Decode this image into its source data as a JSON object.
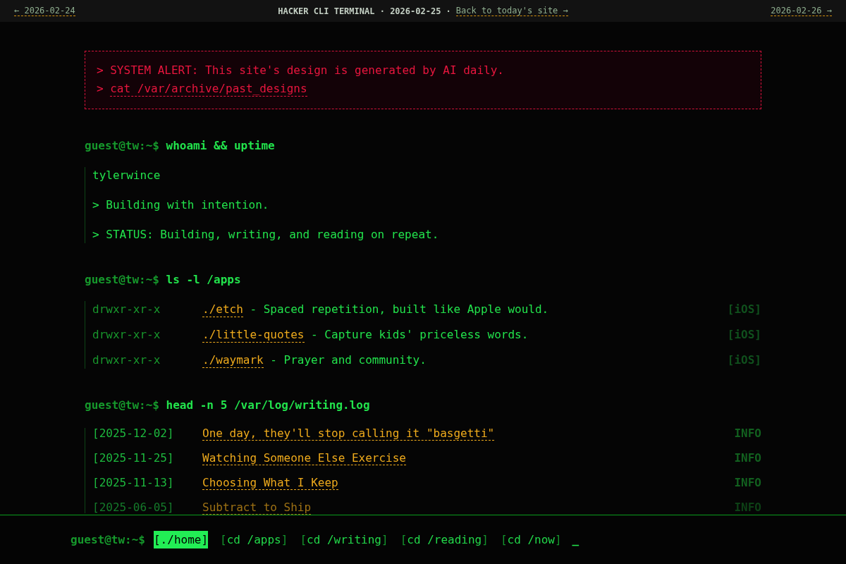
{
  "top_bar": {
    "prev_day": "← 2026-02-24",
    "title": "HACKER CLI TERMINAL · 2026-02-25 ·",
    "back_link": "Back to today's site →",
    "next_day": "2026-02-26 →"
  },
  "alert": {
    "lines": [
      {
        "kind": "text",
        "marker": ">",
        "text": "SYSTEM ALERT: This site's design is generated by AI daily."
      },
      {
        "kind": "link",
        "marker": ">",
        "text": "cat /var/archive/past_designs"
      }
    ]
  },
  "sections": [
    {
      "kind": "output",
      "prompt": "guest@tw:~$",
      "command": "whoami && uptime",
      "lines": [
        "tylerwince",
        "> Building with intention.",
        "> STATUS: Building, writing, and reading on repeat."
      ]
    },
    {
      "kind": "listing",
      "prompt": "guest@tw:~$",
      "command": "ls -l /apps",
      "rows": [
        {
          "permissions": "drwxr-xr-x",
          "name": "./etch",
          "description": "- Spaced repetition, built like Apple would.",
          "tag": "[iOS]"
        },
        {
          "permissions": "drwxr-xr-x",
          "name": "./little-quotes",
          "description": "- Capture kids' priceless words.",
          "tag": "[iOS]"
        },
        {
          "permissions": "drwxr-xr-x",
          "name": "./waymark",
          "description": "- Prayer and community.",
          "tag": "[iOS]"
        }
      ]
    },
    {
      "kind": "log",
      "prompt": "guest@tw:~$",
      "command": "head -n 5 /var/log/writing.log",
      "rows": [
        {
          "date": "[2025-12-02]",
          "title": "One day, they'll stop calling it \"basgetti\"",
          "tag": "INFO",
          "dimmed": false
        },
        {
          "date": "[2025-11-25]",
          "title": "Watching Someone Else Exercise",
          "tag": "INFO",
          "dimmed": false
        },
        {
          "date": "[2025-11-13]",
          "title": "Choosing What I Keep",
          "tag": "INFO",
          "dimmed": false
        },
        {
          "date": "[2025-06-05]",
          "title": "Subtract to Ship",
          "tag": "INFO",
          "dimmed": true
        }
      ]
    }
  ],
  "command_bar": {
    "prompt": "guest@tw:~$",
    "links": [
      {
        "label": "[./home]",
        "selected": true
      },
      {
        "label": "[cd /apps]",
        "selected": false
      },
      {
        "label": "[cd /writing]",
        "selected": false
      },
      {
        "label": "[cd /reading]",
        "selected": false
      },
      {
        "label": "[cd /now]",
        "selected": false
      }
    ],
    "cursor": "_"
  }
}
